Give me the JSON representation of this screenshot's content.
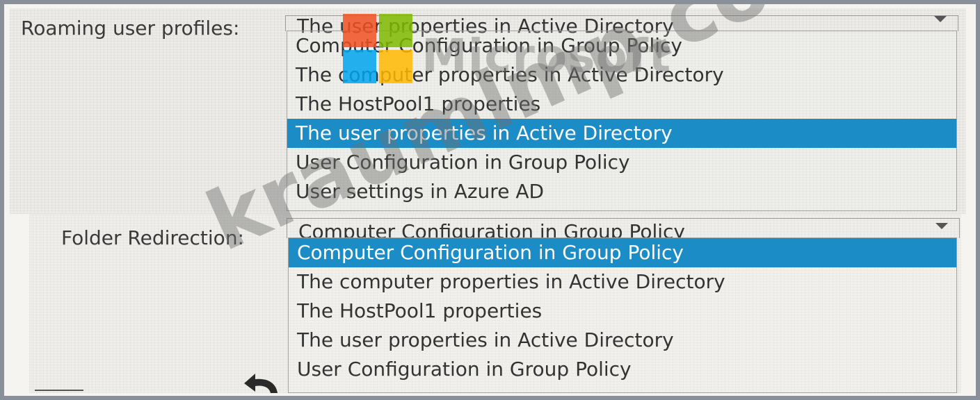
{
  "roaming_profiles": {
    "label": "Roaming user profiles:",
    "selected_value": "The user properties in Active Directory",
    "options": [
      "Computer Configuration in Group Policy",
      "The computer properties in Active Directory",
      "The HostPool1 properties",
      "The user properties in Active Directory",
      "User Configuration in Group Policy",
      "User settings in Azure AD"
    ],
    "highlighted_option": "The user properties in Active Directory"
  },
  "folder_redirection": {
    "label": "Folder Redirection:",
    "selected_value": "Computer Configuration in Group Policy",
    "options": [
      "Computer Configuration in Group Policy",
      "The computer properties in Active Directory",
      "The HostPool1 properties",
      "The user properties in Active Directory",
      "User Configuration in Group Policy"
    ],
    "highlighted_option": "Computer Configuration in Group Policy"
  },
  "watermark": {
    "brand": "Microsoft",
    "site": "kraumlmp.com",
    "logo_colors": [
      "#f25022",
      "#7fba00",
      "#00a4ef",
      "#ffb900"
    ]
  },
  "colors": {
    "highlight": "#1b8cc6",
    "border": "#8a9099"
  },
  "icons": {
    "dropdown": "chevron-down-icon",
    "back": "undo-arrow-icon"
  }
}
